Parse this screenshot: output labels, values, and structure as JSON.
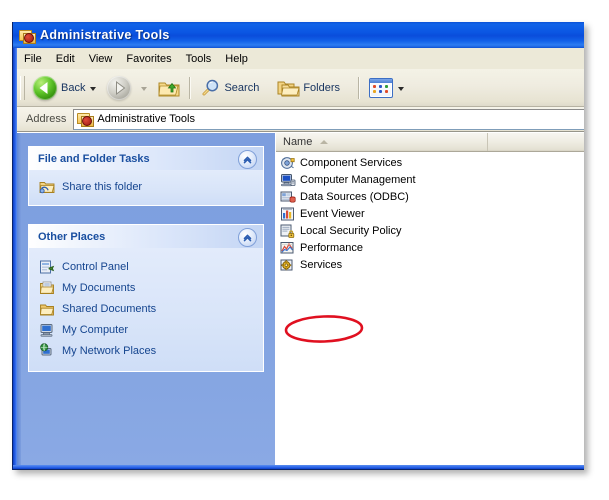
{
  "window": {
    "title": "Administrative Tools",
    "title_icon": "admin-tools-icon"
  },
  "menubar": {
    "items": [
      {
        "label": "File"
      },
      {
        "label": "Edit"
      },
      {
        "label": "View"
      },
      {
        "label": "Favorites"
      },
      {
        "label": "Tools"
      },
      {
        "label": "Help"
      }
    ]
  },
  "toolbar": {
    "back_label": "Back",
    "forward_label": "",
    "search_label": "Search",
    "folders_label": "Folders",
    "back_icon": "back-arrow-icon",
    "forward_icon": "forward-arrow-icon",
    "up_icon": "up-folder-icon",
    "search_icon": "magnifier-icon",
    "folders_icon": "folders-icon",
    "views_icon": "views-icon"
  },
  "address": {
    "label": "Address",
    "value": "Administrative Tools",
    "icon": "admin-tools-icon"
  },
  "sidebar": {
    "panels": [
      {
        "title": "File and Folder Tasks",
        "collapse_icon": "chevron-up-icon",
        "items": [
          {
            "label": "Share this folder",
            "icon": "share-folder-icon"
          }
        ]
      },
      {
        "title": "Other Places",
        "collapse_icon": "chevron-up-icon",
        "items": [
          {
            "label": "Control Panel",
            "icon": "control-panel-icon"
          },
          {
            "label": "My Documents",
            "icon": "my-documents-icon"
          },
          {
            "label": "Shared Documents",
            "icon": "shared-documents-icon"
          },
          {
            "label": "My Computer",
            "icon": "my-computer-icon"
          },
          {
            "label": "My Network Places",
            "icon": "network-places-icon"
          }
        ]
      }
    ]
  },
  "filelist": {
    "column_header": "Name",
    "sort_direction": "ascending",
    "items": [
      {
        "label": "Component Services",
        "icon": "component-services-icon"
      },
      {
        "label": "Computer Management",
        "icon": "computer-management-icon"
      },
      {
        "label": "Data Sources (ODBC)",
        "icon": "data-sources-icon"
      },
      {
        "label": "Event Viewer",
        "icon": "event-viewer-icon"
      },
      {
        "label": "Local Security Policy",
        "icon": "local-security-policy-icon"
      },
      {
        "label": "Performance",
        "icon": "performance-icon"
      },
      {
        "label": "Services",
        "icon": "services-icon"
      }
    ]
  },
  "annotation": {
    "type": "ellipse-highlight",
    "target": "Services",
    "color": "#e01020"
  },
  "colors": {
    "titlebar_blue": "#0b56e3",
    "sidebar_blue": "#7fa1e0",
    "panel_header_text": "#1a4fa0",
    "link_text": "#15458f",
    "toolbar_beige": "#ece9d8",
    "annotation_red": "#e01020"
  }
}
